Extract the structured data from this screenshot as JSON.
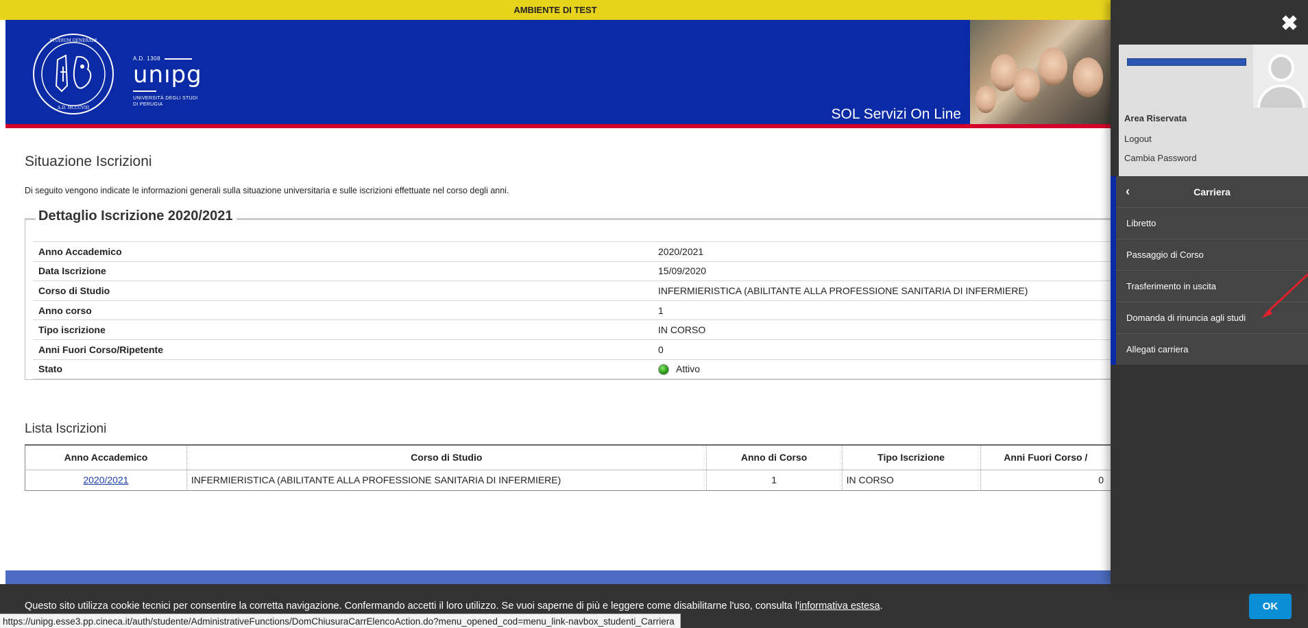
{
  "banner": {
    "text": "AMBIENTE DI TEST"
  },
  "header": {
    "brand_ad": "A.D. 1308",
    "brand_name": "unıpg",
    "brand_sub1": "UNIVERSITÀ DEGLI STUDI",
    "brand_sub2": "DI PERUGIA",
    "seal_text": "STUDIUM GENERALE CIVITATIS PERUSIE · A.D. MCCCVIII",
    "title": "SOL Servizi On Line"
  },
  "main": {
    "title": "Situazione Iscrizioni",
    "description": "Di seguito vengono indicate le informazioni generali sulla situazione universitaria e sulle iscrizioni effettuate nel corso degli anni.",
    "detail": {
      "legend": "Dettaglio Iscrizione 2020/2021",
      "rows": [
        {
          "label": "Anno Accademico",
          "value": "2020/2021"
        },
        {
          "label": "Data Iscrizione",
          "value": "15/09/2020"
        },
        {
          "label": "Corso di Studio",
          "value": "INFERMIERISTICA (ABILITANTE ALLA PROFESSIONE SANITARIA DI INFERMIERE)"
        },
        {
          "label": "Anno corso",
          "value": "1"
        },
        {
          "label": "Tipo iscrizione",
          "value": "IN CORSO"
        },
        {
          "label": "Anni Fuori Corso/Ripetente",
          "value": "0"
        },
        {
          "label": "Stato",
          "value": "Attivo",
          "status_color": "#2c9a18"
        }
      ]
    },
    "list": {
      "title": "Lista Iscrizioni",
      "columns": [
        "Anno Accademico",
        "Corso di Studio",
        "Anno di Corso",
        "Tipo Iscrizione",
        "Anni Fuori Corso /"
      ],
      "rows": [
        {
          "anno": "2020/2021",
          "corso": "INFERMIERISTICA (ABILITANTE ALLA PROFESSIONE SANITARIA DI INFERMIERE)",
          "anno_corso": "1",
          "tipo": "IN CORSO",
          "fuori_corso": "0"
        }
      ]
    }
  },
  "footer": {
    "cookie_text": "Questo sito utilizza cookie tecnici per consentire la corretta navigazione. Confermando accetti il loro utilizzo. Se vuoi saperne di più e leggere come disabilitarne l'uso, consulta l'",
    "cookie_link": "informativa estesa",
    "cookie_end": ".",
    "ok_label": "OK",
    "status_url": "https://unipg.esse3.pp.cineca.it/auth/studente/AdministrativeFunctions/DomChiusuraCarrElencoAction.do?menu_opened_cod=menu_link-navbox_studenti_Carriera"
  },
  "side_panel": {
    "close_icon": "close-icon",
    "area_label": "Area Riservata",
    "logout_label": "Logout",
    "change_password_label": "Cambia Password",
    "nav_title": "Carriera",
    "nav_back_icon": "chevron-left-icon",
    "nav_items": [
      "Libretto",
      "Passaggio di Corso",
      "Trasferimento in uscita",
      "Domanda di rinuncia agli studi",
      "Allegati carriera"
    ],
    "accent_color": "#0a2aa6",
    "annotation_arrow_color": "#e0202a"
  }
}
